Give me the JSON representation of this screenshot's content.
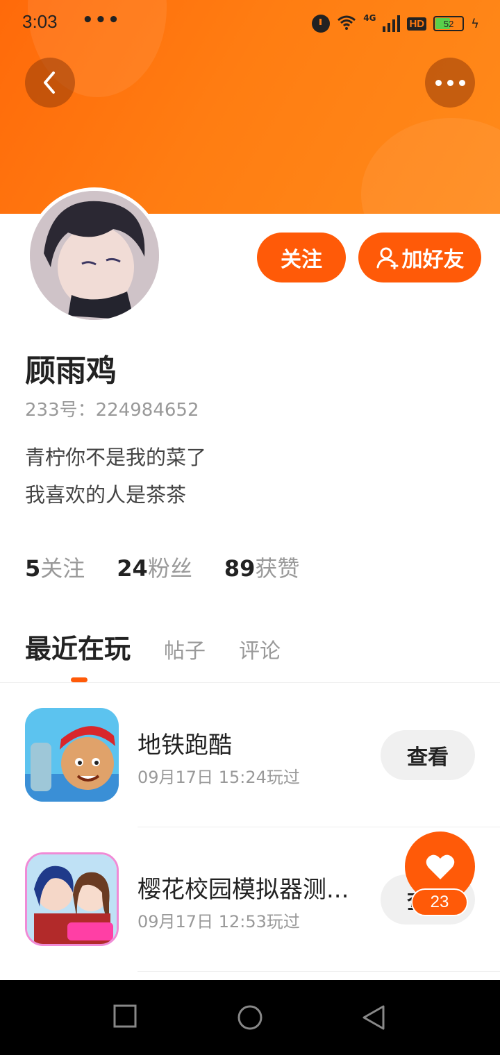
{
  "status_bar": {
    "time": "3:03",
    "dots": "•••",
    "network": "4G",
    "hd": "HD",
    "battery": "52"
  },
  "header": {
    "back_icon": "chevron-left-icon",
    "more_icon": "more-dots-icon",
    "accent_color": "#ff5a08"
  },
  "profile": {
    "name": "顾雨鸡",
    "uid": "233号：224984652",
    "bio_lines": [
      "青柠你不是我的菜了",
      "我喜欢的人是茶茶"
    ],
    "follow_label": "关注",
    "add_friend_label": "加好友"
  },
  "stats": [
    {
      "num": "5",
      "label": "关注"
    },
    {
      "num": "24",
      "label": "粉丝"
    },
    {
      "num": "89",
      "label": "获赞"
    }
  ],
  "tabs": [
    {
      "label": "最近在玩",
      "active": true
    },
    {
      "label": "帖子",
      "active": false
    },
    {
      "label": "评论",
      "active": false
    }
  ],
  "games": [
    {
      "title": "地铁跑酷",
      "time": "09月17日 15:24玩过",
      "action": "查看"
    },
    {
      "title": "樱花校园模拟器测...",
      "time": "09月17日 12:53玩过",
      "action": "查看"
    }
  ],
  "like": {
    "count": "23",
    "icon": "heart-icon"
  },
  "nav": {
    "recent_icon": "square-icon",
    "home_icon": "circle-icon",
    "back_icon": "triangle-back-icon"
  }
}
